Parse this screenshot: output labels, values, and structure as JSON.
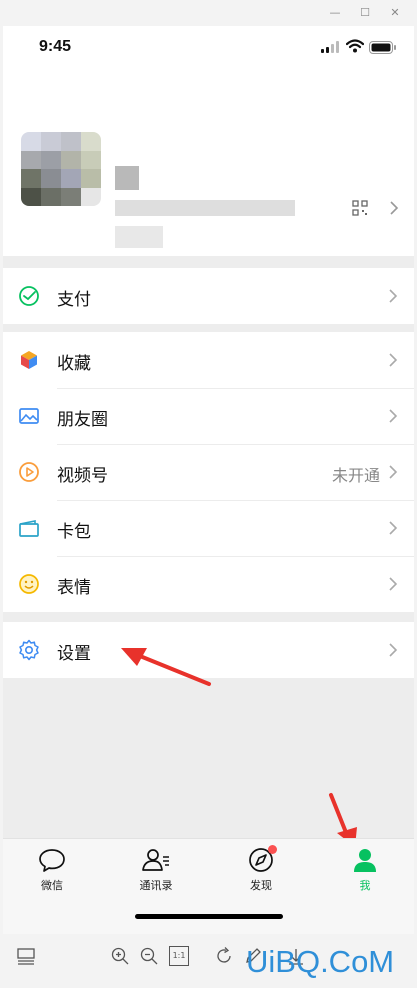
{
  "window": {
    "minimize_glyph": "—",
    "maximize_glyph": "☐",
    "close_glyph": "✕"
  },
  "status_bar": {
    "time": "9:45",
    "icons": [
      "cellular-signal-icon",
      "wifi-icon",
      "battery-icon"
    ]
  },
  "profile": {
    "avatar": "pixelated-avatar",
    "name": "",
    "wechat_id": "",
    "qr_icon": "qr-code-icon"
  },
  "menu": {
    "pay": {
      "label": "支付",
      "icon": "wallet-check-icon"
    },
    "favorites": {
      "label": "收藏",
      "icon": "cube-icon"
    },
    "moments": {
      "label": "朋友圈",
      "icon": "picture-icon"
    },
    "channels": {
      "label": "视频号",
      "value": "未开通",
      "icon": "play-circle-icon"
    },
    "cards": {
      "label": "卡包",
      "icon": "card-icon"
    },
    "stickers": {
      "label": "表情",
      "icon": "smiley-icon"
    },
    "settings": {
      "label": "设置",
      "icon": "gear-icon"
    }
  },
  "tabbar": {
    "tabs": [
      {
        "label": "微信",
        "icon": "chat-bubble-icon",
        "active": false
      },
      {
        "label": "通讯录",
        "icon": "contacts-icon",
        "active": false
      },
      {
        "label": "发现",
        "icon": "compass-icon",
        "active": false,
        "badge": true
      },
      {
        "label": "我",
        "icon": "person-icon",
        "active": true
      }
    ]
  },
  "toolbar": {
    "icons": [
      "layout-icon",
      "zoom-in-icon",
      "zoom-out-icon",
      "actual-size-icon",
      "rotate-icon",
      "pen-icon",
      "download-icon"
    ],
    "actual_size_label": "1:1"
  },
  "watermark": "UiBQ.CoM",
  "colors": {
    "accent_green": "#07c160",
    "annotation_red": "#e8322b",
    "badge_red": "#fa5151",
    "watermark_blue": "#2f8fd8"
  }
}
